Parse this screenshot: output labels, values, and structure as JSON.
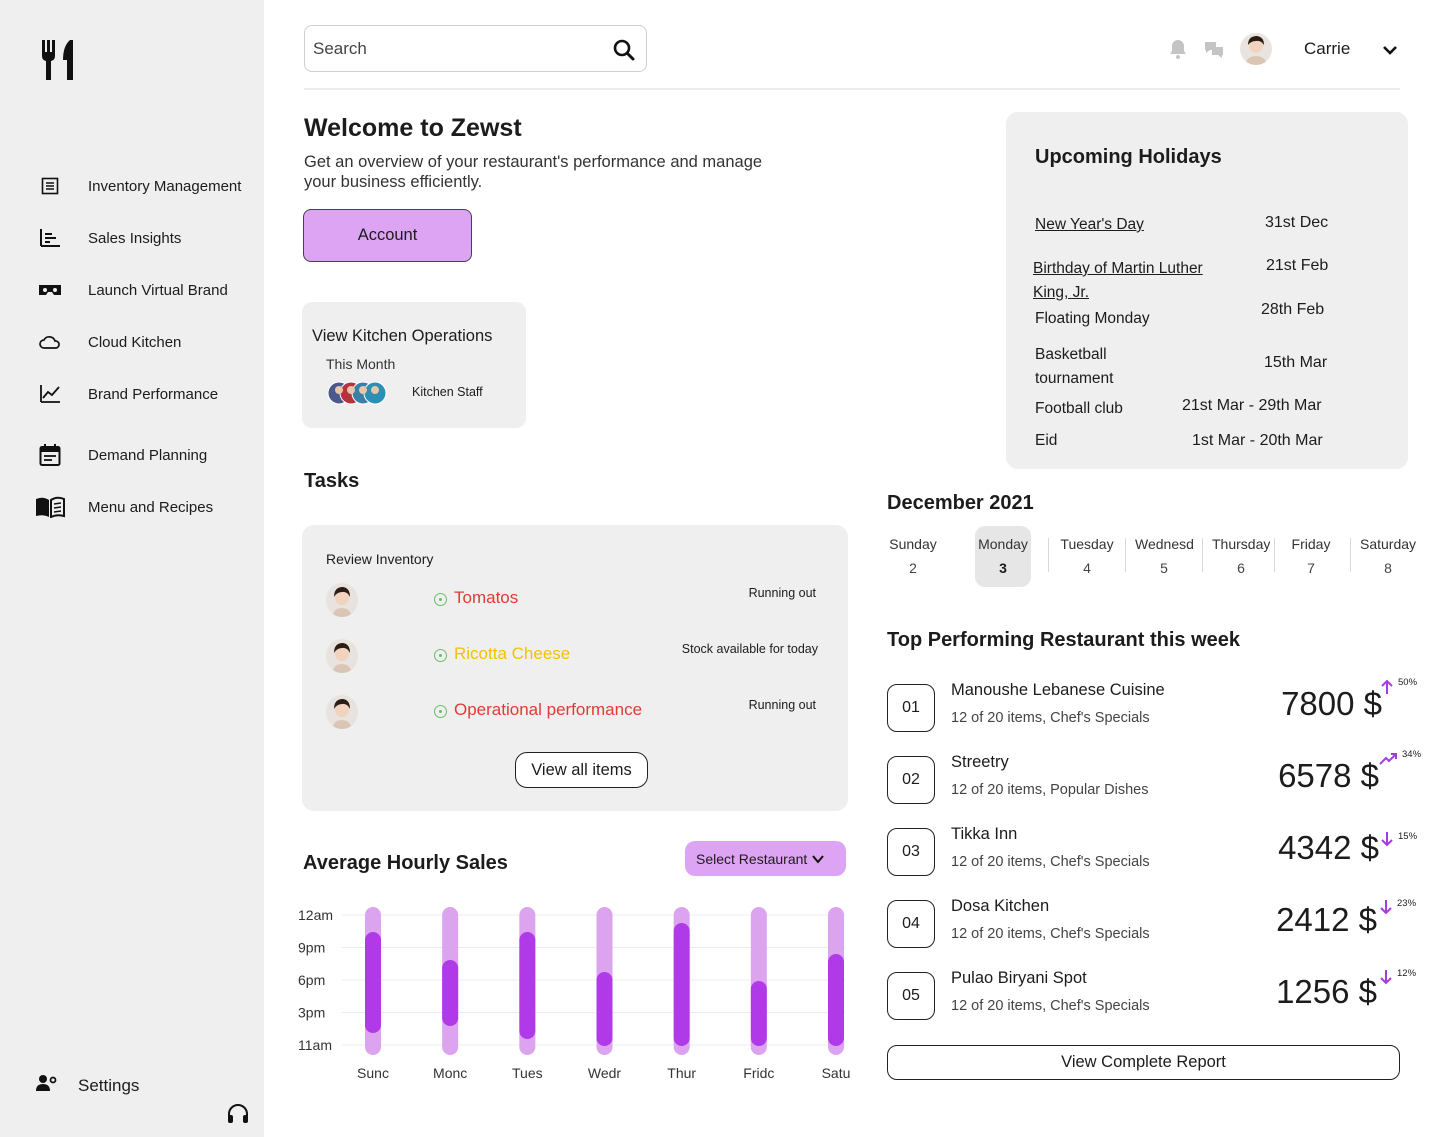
{
  "sidebar": {
    "logo_icon": "fork-knife-icon",
    "items": [
      {
        "label": "Inventory Management",
        "icon": "list-icon"
      },
      {
        "label": "Sales Insights",
        "icon": "bar-chart-icon"
      },
      {
        "label": "Launch Virtual Brand",
        "icon": "vr-headset-icon"
      },
      {
        "label": "Cloud Kitchen",
        "icon": "cloud-icon"
      },
      {
        "label": "Brand Performance",
        "icon": "line-chart-icon"
      },
      {
        "label": "Demand Planning",
        "icon": "calendar-icon"
      },
      {
        "label": "Menu and Recipes",
        "icon": "book-icon"
      }
    ],
    "settings_label": "Settings",
    "support_icon": "headset-icon"
  },
  "header": {
    "search_placeholder": "Search",
    "user_name": "Carrie"
  },
  "welcome": {
    "title": "Welcome to Zewst",
    "subtitle": "Get an overview of your restaurant's performance and manage your business efficiently.",
    "account_button": "Account"
  },
  "kitchen": {
    "title": "View Kitchen Operations",
    "period": "This Month",
    "staff_label": "Kitchen Staff"
  },
  "holidays": {
    "title": "Upcoming Holidays",
    "items": [
      {
        "name": "New Year's Day",
        "date": "31st Dec"
      },
      {
        "name": "Birthday of Martin Luther King, Jr.",
        "date": "21st Feb"
      },
      {
        "name": "Floating Monday",
        "date": "28th Feb"
      },
      {
        "name": "Basketball tournament",
        "date": "15th Mar"
      },
      {
        "name": "Football club",
        "date": "21st Mar - 29th Mar"
      },
      {
        "name": "Eid",
        "date": "1st Mar - 20th Mar"
      }
    ]
  },
  "tasks": {
    "title": "Tasks",
    "subtitle": "Review Inventory",
    "items": [
      {
        "name": "Tomatos",
        "status": "Running out",
        "color": "#e53935"
      },
      {
        "name": "Ricotta Cheese",
        "status": "Stock available for today",
        "color": "#f2c200"
      },
      {
        "name": "Operational performance",
        "status": "Running out",
        "color": "#e53935"
      }
    ],
    "view_all_button": "View all items"
  },
  "hourly_sales": {
    "title": "Average Hourly Sales",
    "select_label": "Select Restaurant"
  },
  "chart_data": {
    "type": "bar",
    "title": "Average Hourly Sales",
    "categories": [
      "Sunc",
      "Monc",
      "Tues",
      "Wedr",
      "Thur",
      "Fridc",
      "Satu"
    ],
    "y_ticks": [
      "12am",
      "9pm",
      "6pm",
      "3pm",
      "11am"
    ],
    "ylim": [
      "11am",
      "12am"
    ],
    "series": [
      {
        "start": [
          1.3,
          2.0,
          0.7,
          0.0,
          0.0,
          0.0,
          0.0
        ],
        "end": [
          11.3,
          8.5,
          11.3,
          7.3,
          12.2,
          6.4,
          9.1
        ]
      }
    ],
    "track_color": "#dca3ef",
    "bar_color": "#b03ae8",
    "grid": true
  },
  "calendar": {
    "title": "December 2021",
    "days": [
      {
        "name": "Sunday",
        "num": "2"
      },
      {
        "name": "Monday",
        "num": "3",
        "active": true
      },
      {
        "name": "Tuesday",
        "num": "4"
      },
      {
        "name": "Wednesday",
        "num": "5"
      },
      {
        "name": "Thursday",
        "num": "6"
      },
      {
        "name": "Friday",
        "num": "7"
      },
      {
        "name": "Saturday",
        "num": "8"
      }
    ]
  },
  "top_performing": {
    "title": "Top Performing Restaurant this week",
    "items": [
      {
        "rank": "01",
        "name": "Manoushe Lebanese Cuisine",
        "sub": "12 of 20 items, Chef's Specials",
        "amount": "7800 $",
        "trend": "up",
        "pct": "50%"
      },
      {
        "rank": "02",
        "name": "Streetry",
        "sub": "12 of 20 items, Popular Dishes",
        "amount": "6578 $",
        "trend": "trending-up",
        "pct": "34%"
      },
      {
        "rank": "03",
        "name": "Tikka Inn",
        "sub": "12 of 20 items, Chef's Specials",
        "amount": "4342 $",
        "trend": "down",
        "pct": "15%"
      },
      {
        "rank": "04",
        "name": "Dosa Kitchen",
        "sub": "12 of 20 items, Chef's Specials",
        "amount": "2412 $",
        "trend": "down",
        "pct": "23%"
      },
      {
        "rank": "05",
        "name": "Pulao Biryani Spot",
        "sub": "12 of 20 items, Chef's Specials",
        "amount": "1256 $",
        "trend": "down",
        "pct": "12%"
      }
    ],
    "report_button": "View Complete Report",
    "trend_color": "#a43be0"
  }
}
